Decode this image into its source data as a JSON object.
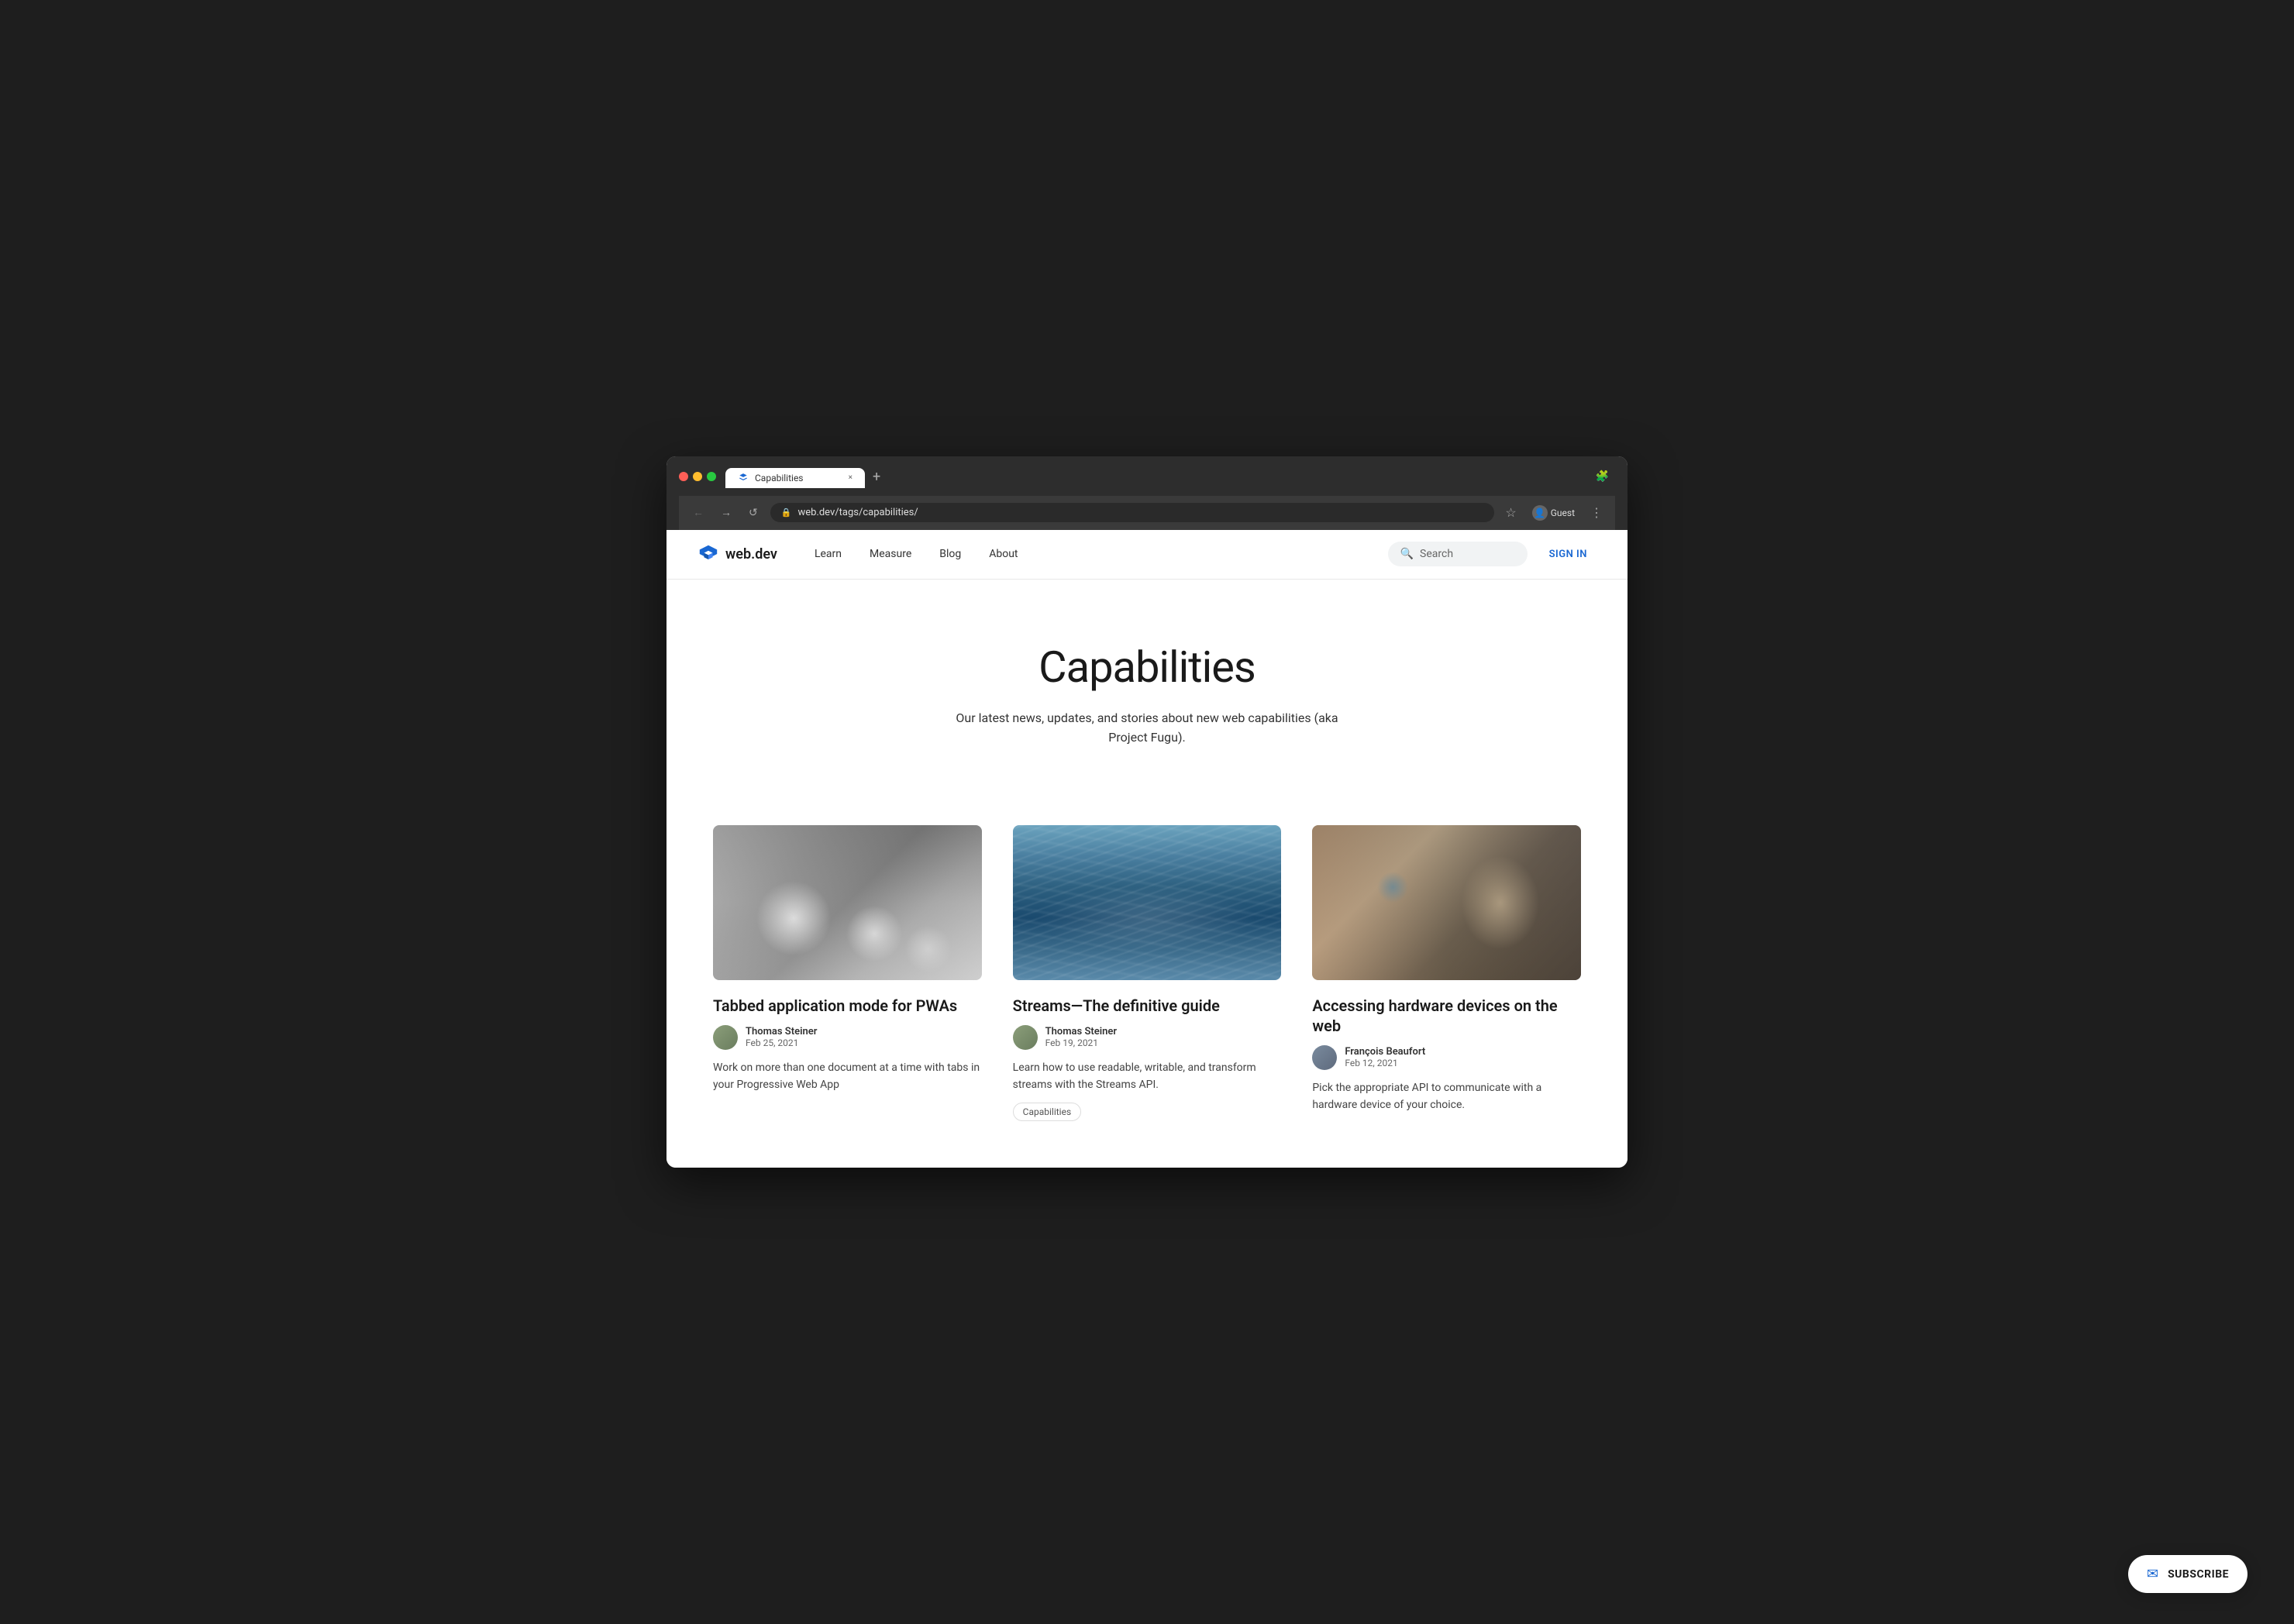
{
  "browser": {
    "tab_title": "Capabilities",
    "tab_close_label": "×",
    "new_tab_label": "+",
    "nav_back": "←",
    "nav_forward": "→",
    "nav_refresh": "↺",
    "address": "web.dev/tags/capabilities/",
    "extensions_icon": "🧩",
    "profile_label": "Guest",
    "more_icon": "⋮"
  },
  "nav": {
    "logo_text": "web.dev",
    "links": [
      {
        "label": "Learn",
        "id": "learn"
      },
      {
        "label": "Measure",
        "id": "measure"
      },
      {
        "label": "Blog",
        "id": "blog"
      },
      {
        "label": "About",
        "id": "about"
      }
    ],
    "search_placeholder": "Search",
    "sign_in": "SIGN IN"
  },
  "hero": {
    "title": "Capabilities",
    "subtitle": "Our latest news, updates, and stories about new web capabilities (aka Project Fugu)."
  },
  "articles": [
    {
      "id": "tabbed-pwa",
      "title": "Tabbed application mode for PWAs",
      "author_name": "Thomas Steiner",
      "author_date": "Feb 25, 2021",
      "description": "Work on more than one document at a time with tabs in your Progressive Web App",
      "image_type": "chess",
      "tags": []
    },
    {
      "id": "streams-guide",
      "title": "Streams—The definitive guide",
      "author_name": "Thomas Steiner",
      "author_date": "Feb 19, 2021",
      "description": "Learn how to use readable, writable, and transform streams with the Streams API.",
      "image_type": "streams",
      "tags": [
        "Capabilities"
      ]
    },
    {
      "id": "hardware-devices",
      "title": "Accessing hardware devices on the web",
      "author_name": "François Beaufort",
      "author_date": "Feb 12, 2021",
      "description": "Pick the appropriate API to communicate with a hardware device of your choice.",
      "image_type": "hardware",
      "tags": []
    }
  ],
  "subscribe": {
    "label": "SUBSCRIBE",
    "icon": "✉"
  }
}
